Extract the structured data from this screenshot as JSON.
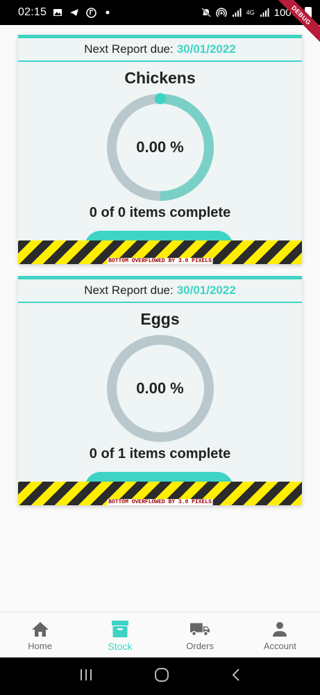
{
  "status_bar": {
    "time": "02:15",
    "network": "4G",
    "battery": "100%",
    "debug_label": "DEBUG"
  },
  "cards": [
    {
      "due_label": "Next Report due:",
      "due_date": "30/01/2022",
      "title": "Chickens",
      "percent_text": "0.00 %",
      "items_text": "0 of 0 items complete",
      "overflow_text": "BOTTOM OVERFLOWED BY 3.0 PIXELS"
    },
    {
      "due_label": "Next Report due:",
      "due_date": "30/01/2022",
      "title": "Eggs",
      "percent_text": "0.00 %",
      "items_text": "0 of 1 items complete",
      "overflow_text": "BOTTOM OVERFLOWED BY 3.0 PIXELS"
    }
  ],
  "bottom_nav": {
    "items": [
      {
        "label": "Home",
        "icon": "home-icon"
      },
      {
        "label": "Stock",
        "icon": "archive-box-icon"
      },
      {
        "label": "Orders",
        "icon": "truck-icon"
      },
      {
        "label": "Account",
        "icon": "person-icon"
      }
    ],
    "active": "Stock"
  },
  "colors": {
    "accent": "#3ed3c4",
    "card_bg": "#eff4f4",
    "ring_track": "#b8c8cc",
    "ring_progress": "#7ad0c6"
  }
}
